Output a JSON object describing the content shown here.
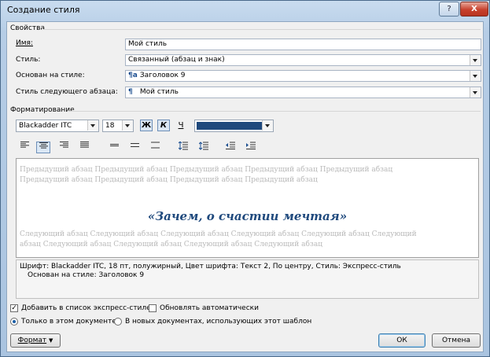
{
  "window": {
    "title": "Создание стиля",
    "help_glyph": "?",
    "close_glyph": "X"
  },
  "properties": {
    "section_title": "Свойства",
    "name_label": "Имя:",
    "name_value": "Мой стиль",
    "style_type_label": "Стиль:",
    "style_type_value": "Связанный (абзац и знак)",
    "based_on_label": "Основан на стиле:",
    "based_on_glyph": "¶a",
    "based_on_value": "Заголовок 9",
    "next_style_label": "Стиль следующего абзаца:",
    "next_style_glyph": "¶",
    "next_style_value": "Мой стиль"
  },
  "formatting": {
    "section_title": "Форматирование",
    "font_name": "Blackadder ITC",
    "font_size": "18",
    "bold_glyph": "Ж",
    "italic_glyph": "К",
    "underline_glyph": "Ч",
    "font_color": "#1f497d"
  },
  "preview": {
    "previous_paragraph": "Предыдущий абзац Предыдущий абзац Предыдущий абзац Предыдущий абзац Предыдущий абзац Предыдущий абзац Предыдущий абзац Предыдущий абзац Предыдущий абзац",
    "sample_text": "«Зачем, о счастии мечтая»",
    "next_paragraph": "Следующий абзац Следующий абзац Следующий абзац Следующий абзац Следующий абзац Следующий абзац Следующий абзац Следующий абзац Следующий абзац Следующий абзац"
  },
  "description": {
    "line1": "Шрифт: Blackadder ITC, 18 пт, полужирный, Цвет шрифта: Текст 2, По центру, Стиль: Экспресс-стиль",
    "line2": "Основан на стиле: Заголовок 9"
  },
  "options": {
    "add_to_quick_styles": {
      "label": "Добавить в список экспресс-стилей",
      "checked": true
    },
    "auto_update": {
      "label": "Обновлять автоматически",
      "checked": false
    },
    "only_this_document": {
      "label": "Только в этом документе",
      "selected": true
    },
    "new_documents": {
      "label": "В новых документах, использующих этот шаблон",
      "selected": false
    }
  },
  "buttons": {
    "format": "Формат",
    "ok": "ОК",
    "cancel": "Отмена"
  }
}
